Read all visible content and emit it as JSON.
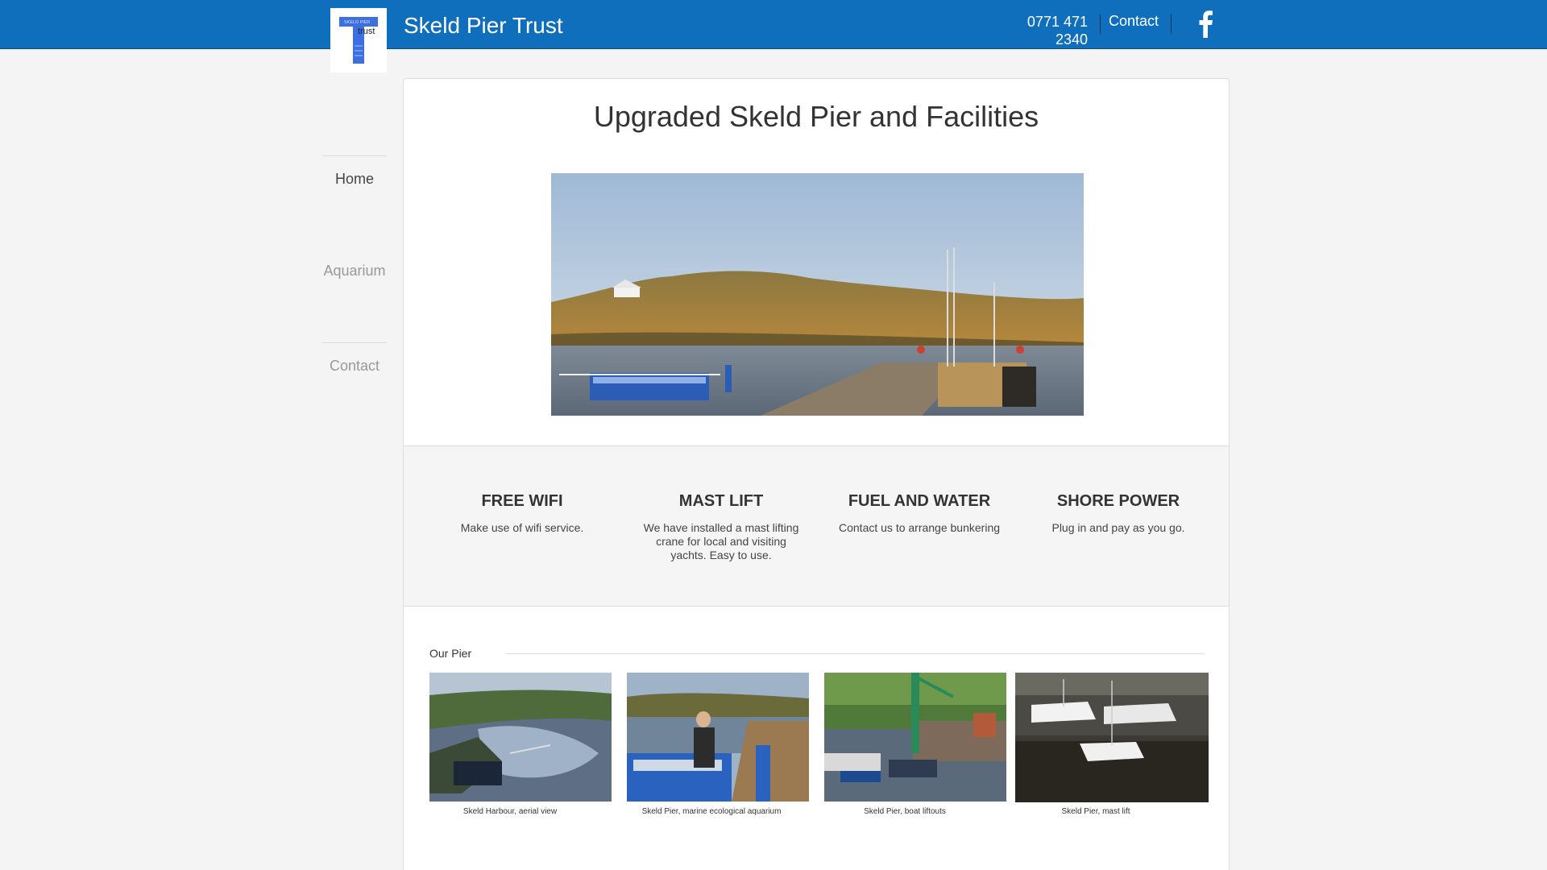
{
  "header": {
    "site_title": "Skeld Pier Trust",
    "phone_line1": "0771 471",
    "phone_line2": "2340",
    "contact_label": "Contact",
    "brand_color": "#0f6fbd",
    "logo_text_top": "SKELD PIER",
    "logo_text_main": "trust"
  },
  "nav": {
    "items": [
      {
        "label": "Home",
        "active": true
      },
      {
        "label": "Aquarium",
        "active": false
      },
      {
        "label": "Contact",
        "active": false
      }
    ]
  },
  "main": {
    "title": "Upgraded Skeld Pier and Facilities",
    "features": [
      {
        "heading": "FREE WIFI",
        "text": "Make  use of wifi service."
      },
      {
        "heading": "MAST LIFT",
        "text": "We have installed a mast lifting crane for local and visiting yachts. Easy to use."
      },
      {
        "heading": "FUEL AND WATER",
        "text": "Contact us to arrange bunkering"
      },
      {
        "heading": "SHORE POWER",
        "text": "Plug in and pay as you go."
      }
    ],
    "gallery_title": "Our Pier",
    "gallery": [
      {
        "caption": "Skeld Harbour, aerial view"
      },
      {
        "caption": "Skeld Pier, marine ecological aquarium"
      },
      {
        "caption": "Skeld Pier, boat liftouts"
      },
      {
        "caption": "Skeld Pier, mast lift"
      }
    ]
  },
  "icons": {
    "facebook": "facebook-icon"
  }
}
